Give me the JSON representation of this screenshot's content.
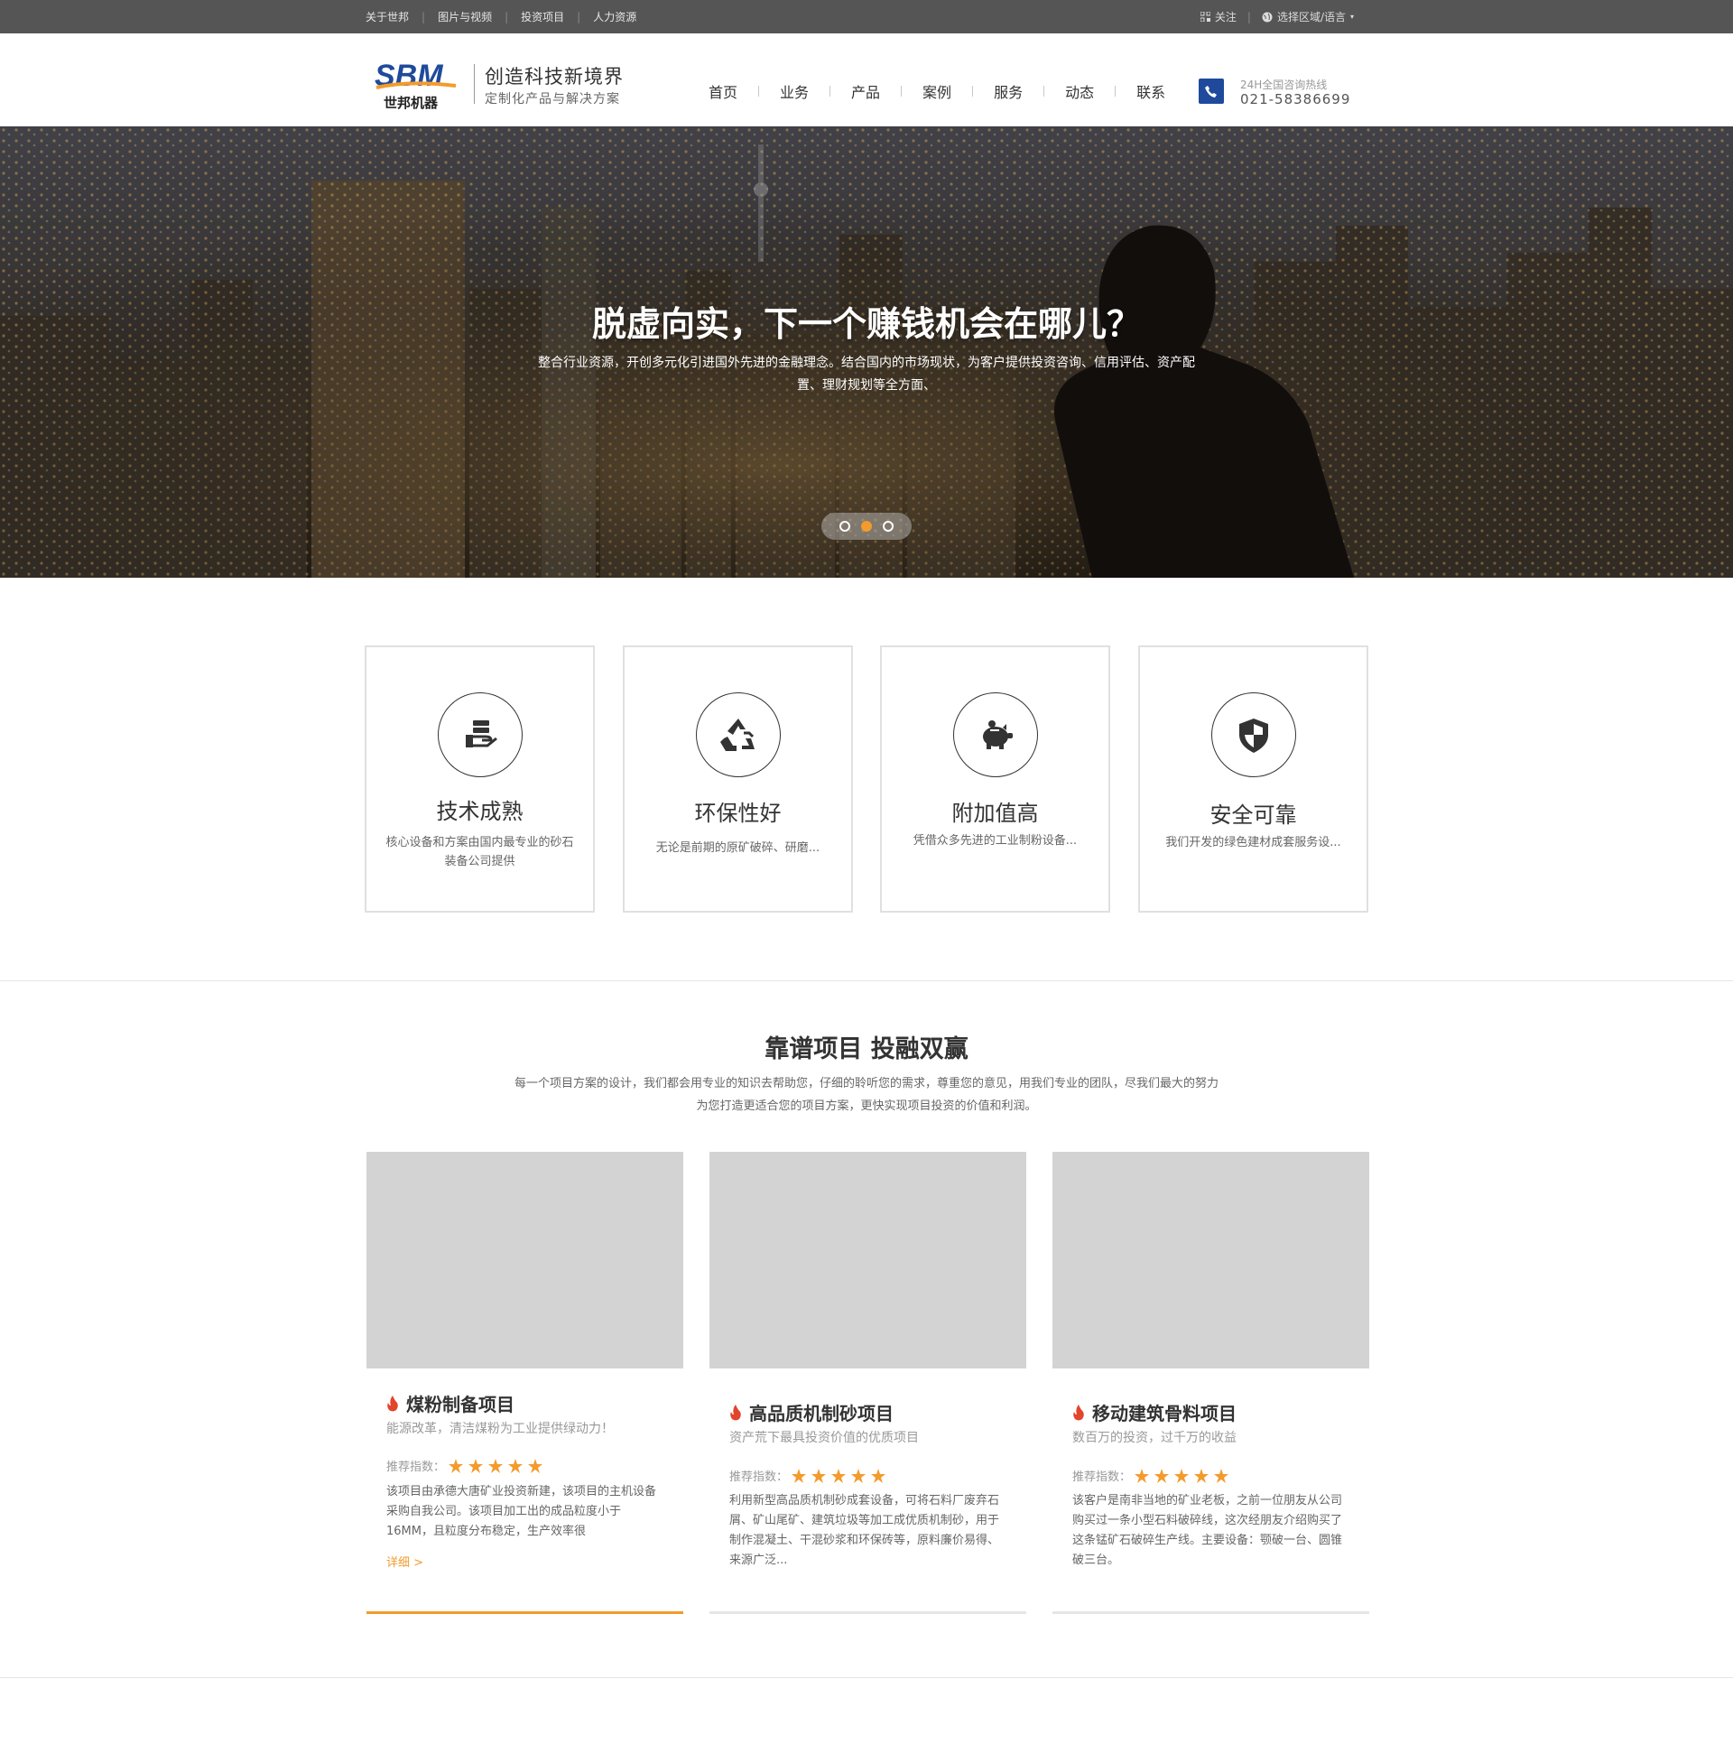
{
  "topbar": {
    "links": [
      "关于世邦",
      "图片与视频",
      "投资项目",
      "人力资源"
    ],
    "follow": "关注",
    "region": "选择区域/语言"
  },
  "header": {
    "logo_text": "SBM",
    "logo_cn": "世邦机器",
    "slogan": "创造科技新境界",
    "sub_slogan": "定制化产品与解决方案",
    "nav": [
      "首页",
      "业务",
      "产品",
      "案例",
      "服务",
      "动态",
      "联系"
    ],
    "hotline_label": "24H全国咨询热线",
    "hotline_number": "021-58386699"
  },
  "hero": {
    "title": "脱虚向实，下一个赚钱机会在哪儿？",
    "description": "整合行业资源，开创多元化引进国外先进的金融理念。结合国内的市场现状，为客户提供投资咨询、信用评估、资产配置、理财规划等全方面、",
    "slides": 3,
    "active_slide": 2
  },
  "features": [
    {
      "icon": "hand-server-icon",
      "title": "技术成熟",
      "desc": "核心设备和方案由国内最专业的砂石装备公司提供"
    },
    {
      "icon": "recycle-icon",
      "title": "环保性好",
      "desc": "无论是前期的原矿破碎、研磨..."
    },
    {
      "icon": "piggy-bank-icon",
      "title": "附加值高",
      "desc": "凭借众多先进的工业制粉设备..."
    },
    {
      "icon": "shield-icon",
      "title": "安全可靠",
      "desc": "我们开发的绿色建材成套服务设..."
    }
  ],
  "section": {
    "title": "靠谱项目 投融双赢",
    "desc": "每一个项目方案的设计，我们都会用专业的知识去帮助您，仔细的聆听您的需求，尊重您的意见，用我们专业的团队，尽我们最大的努力为您打造更适合您的项目方案，更快实现项目投资的价值和利润。"
  },
  "projects": [
    {
      "title": "煤粉制备项目",
      "subtitle": "能源改革，清洁煤粉为工业提供绿动力！",
      "rating_label": "推荐指数：",
      "rating": 5,
      "desc": "该项目由承德大唐矿业投资新建，该项目的主机设备采购自我公司。该项目加工出的成品粒度小于16MM，且粒度分布稳定，生产效率很",
      "more": "详细 >",
      "active": true
    },
    {
      "title": "高品质机制砂项目",
      "subtitle": "资产荒下最具投资价值的优质项目",
      "rating_label": "推荐指数：",
      "rating": 5,
      "desc": "利用新型高品质机制砂成套设备，可将石料厂废弃石屑、矿山尾矿、建筑垃圾等加工成优质机制砂，用于制作混凝土、干混砂浆和环保砖等，原料廉价易得、来源广泛...",
      "more": "",
      "active": false
    },
    {
      "title": "移动建筑骨料项目",
      "subtitle": "数百万的投资，过千万的收益",
      "rating_label": "推荐指数：",
      "rating": 5,
      "desc": "该客户是南非当地的矿业老板，之前一位朋友从公司购买过一条小型石料破碎线，这次经朋友介绍购买了这条锰矿石破碎生产线。主要设备：颚破一台、圆锥破三台。",
      "more": "",
      "active": false
    }
  ],
  "colors": {
    "accent": "#f39b2c",
    "brand_blue": "#1f4a9c",
    "topbar": "#555555"
  }
}
